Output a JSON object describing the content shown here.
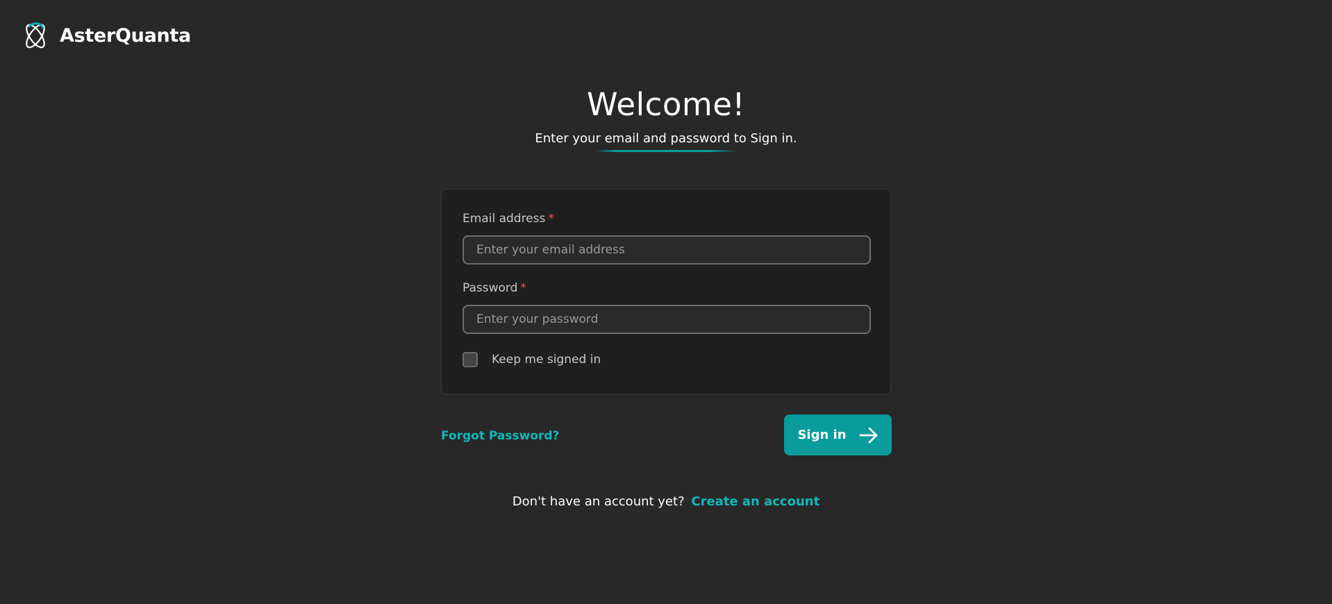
{
  "brand": {
    "name": "AsterQuanta",
    "logo_icon": "atom-orbit-logo-icon",
    "accent_color": "#0a9c9c"
  },
  "hero": {
    "title": "Welcome!",
    "subtitle": "Enter your email and password to Sign in."
  },
  "form": {
    "email": {
      "label": "Email address",
      "required_marker": "*",
      "placeholder": "Enter your email address",
      "value": ""
    },
    "password": {
      "label": "Password",
      "required_marker": "*",
      "placeholder": "Enter your password",
      "value": ""
    },
    "remember": {
      "label": "Keep me signed in",
      "checked": false
    }
  },
  "actions": {
    "forgot_label": "Forgot Password?",
    "signin_label": "Sign in",
    "signin_icon": "arrow-right-icon"
  },
  "footer": {
    "prompt": "Don't have an account yet?",
    "create_label": "Create an account"
  },
  "colors": {
    "background": "#282828",
    "card": "#1f1f1f",
    "link": "#13b8b8",
    "required": "#ff4d4f"
  }
}
